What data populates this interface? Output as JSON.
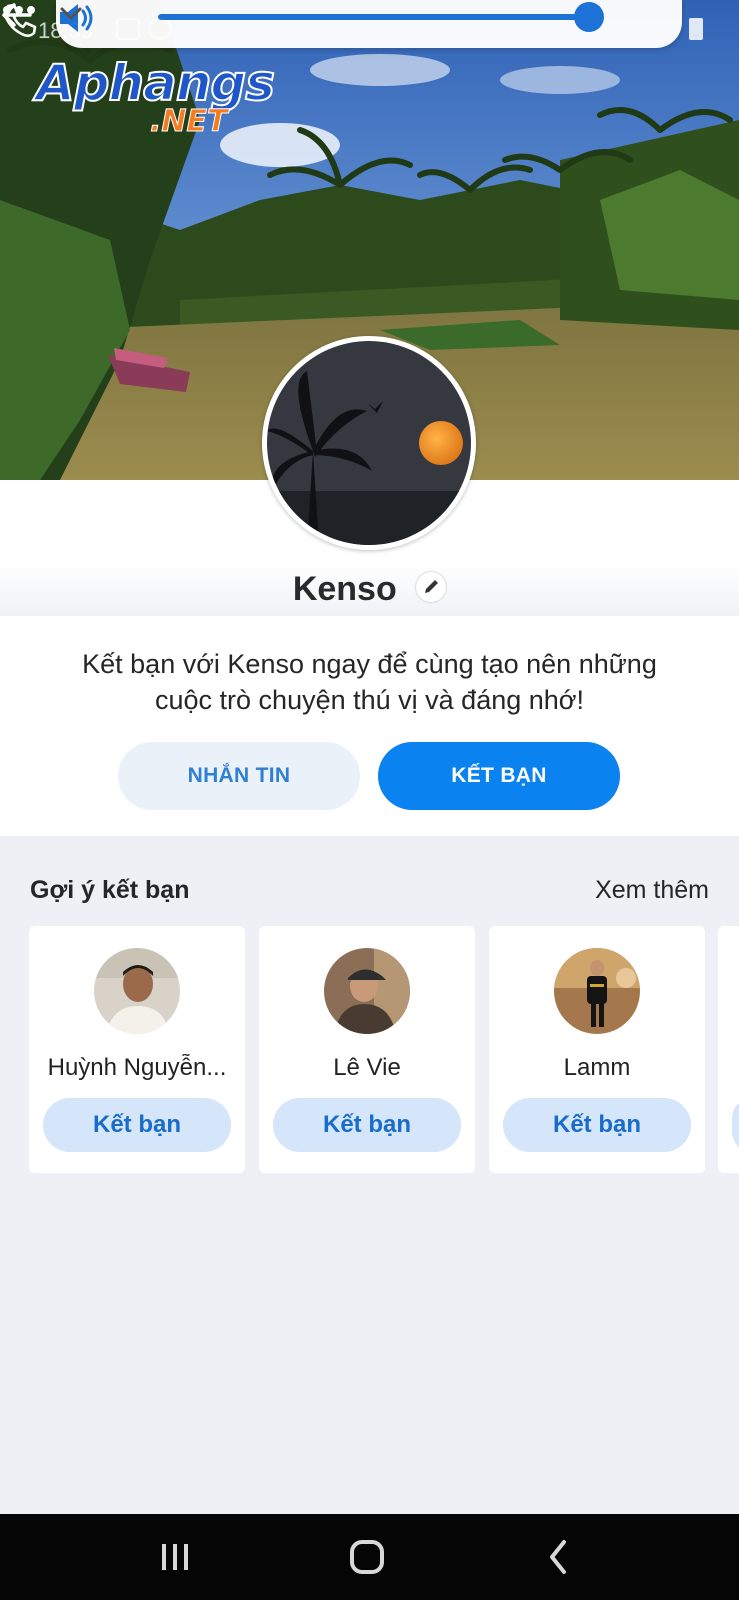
{
  "status_bar": {
    "time": "18:39"
  },
  "watermark": {
    "top": "Aphangs",
    "bottom": ".NET"
  },
  "profile": {
    "name": "Kenso"
  },
  "intro": {
    "line1": "Kết bạn với Kenso ngay để cùng tạo nên những",
    "line2": "cuộc trò chuyện thú vị và đáng nhớ!",
    "message_label": "NHẮN TIN",
    "add_friend_label": "KẾT BẠN"
  },
  "suggestions": {
    "title": "Gợi ý kết bạn",
    "more_label": "Xem thêm",
    "people": [
      {
        "name": "Huỳnh Nguyễn...",
        "button": "Kết bạn"
      },
      {
        "name": "Lê Vie",
        "button": "Kết bạn"
      },
      {
        "name": "Lamm",
        "button": "Kết bạn"
      }
    ]
  },
  "colors": {
    "accent": "#0a82f0",
    "secondary_button_bg": "#eaf1f9",
    "page_bg": "#eef0f5",
    "nav_bg": "#050505"
  },
  "icons": [
    "volume-icon",
    "chevron-down-icon",
    "back-arrow-icon",
    "phone-icon",
    "more-icon",
    "edit-pencil-icon",
    "recents-icon",
    "home-icon",
    "back-nav-icon"
  ]
}
